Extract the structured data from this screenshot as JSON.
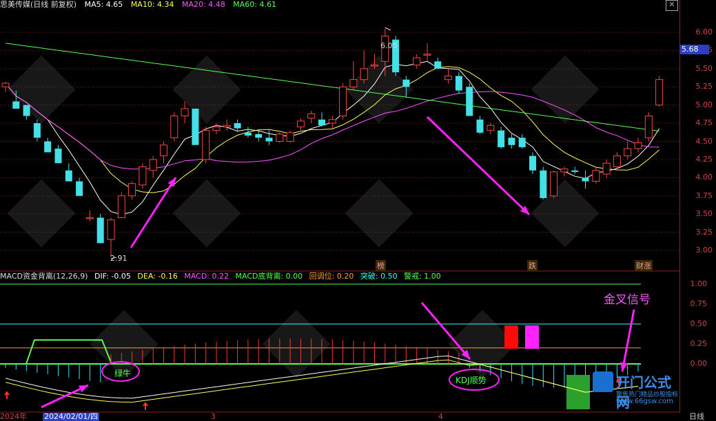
{
  "header": {
    "title": "思美传媒(日线 前复权)",
    "ma": [
      {
        "label": "MA5: 4.65",
        "color": "#ffffff"
      },
      {
        "label": "MA10: 4.34",
        "color": "#ffff55"
      },
      {
        "label": "MA20: 4.48",
        "color": "#ff55ff"
      },
      {
        "label": "MA60: 4.61",
        "color": "#55ff55"
      }
    ]
  },
  "price_axis": {
    "ticks": [
      "6.00",
      "5.75",
      "5.50",
      "5.25",
      "5.00",
      "4.75",
      "4.50",
      "4.25",
      "4.00",
      "3.75",
      "3.50",
      "3.25",
      "3.00"
    ],
    "current": "5.68"
  },
  "annotations": {
    "high": "6.05",
    "low": "2.91",
    "tag_bang": "榜",
    "tag_die": "跌",
    "tag_caizhang": "财涨"
  },
  "macd_header": {
    "name": "MACD资金背离(12,26,9)",
    "items": [
      {
        "label": "DIF: -0.05",
        "color": "#ffffff"
      },
      {
        "label": "DEA: -0.16",
        "color": "#ffff55"
      },
      {
        "label": "MACD: 0.22",
        "color": "#ff55ff"
      },
      {
        "label": "MACD底背离: 0.00",
        "color": "#55ff55"
      },
      {
        "label": "回调位: 0.20",
        "color": "#ff9933"
      },
      {
        "label": "突破: 0.50",
        "color": "#33ffff"
      },
      {
        "label": "警戒: 1.00",
        "color": "#55ff55"
      }
    ]
  },
  "macd_axis": {
    "ticks": [
      "1.00",
      "0.75",
      "0.50",
      "0.25",
      "0.00"
    ]
  },
  "macd_labels": {
    "green_cow": "绿牛",
    "kdj": "KDJ顺势",
    "golden_cross": "金叉信号"
  },
  "dates": {
    "year": "2024年",
    "sel": "2024/02/01/四",
    "m3": "3",
    "m4": "4",
    "period": "日线"
  },
  "watermark": {
    "brand": "开门公式网",
    "slogan": "聚焦热门精品炒股指标公式",
    "url": "www.66gsw.com"
  },
  "chart_data": {
    "type": "candlestick",
    "ylim": [
      2.85,
      6.25
    ],
    "candles": [
      [
        5.25,
        5.32,
        5.18,
        5.3
      ],
      [
        5.05,
        5.2,
        4.95,
        4.95
      ],
      [
        5.0,
        5.0,
        4.8,
        4.85
      ],
      [
        4.75,
        4.8,
        4.5,
        4.55
      ],
      [
        4.5,
        4.55,
        4.35,
        4.35
      ],
      [
        4.4,
        4.45,
        4.2,
        4.2
      ],
      [
        4.1,
        4.2,
        3.95,
        3.95
      ],
      [
        3.95,
        4.0,
        3.75,
        3.75
      ],
      [
        3.45,
        3.55,
        3.4,
        3.45
      ],
      [
        3.45,
        3.5,
        3.1,
        3.1
      ],
      [
        3.15,
        3.45,
        2.91,
        3.42
      ],
      [
        3.45,
        3.8,
        3.45,
        3.75
      ],
      [
        3.75,
        3.95,
        3.7,
        3.92
      ],
      [
        3.9,
        4.2,
        3.85,
        4.15
      ],
      [
        4.1,
        4.3,
        4.0,
        4.25
      ],
      [
        4.3,
        4.5,
        4.2,
        4.45
      ],
      [
        4.55,
        4.9,
        4.5,
        4.85
      ],
      [
        4.85,
        5.05,
        4.75,
        4.95
      ],
      [
        4.95,
        4.95,
        4.5,
        4.45
      ],
      [
        4.25,
        4.7,
        4.2,
        4.65
      ],
      [
        4.65,
        4.75,
        4.6,
        4.7
      ],
      [
        4.7,
        4.8,
        4.65,
        4.72
      ],
      [
        4.75,
        4.8,
        4.65,
        4.68
      ],
      [
        4.62,
        4.7,
        4.55,
        4.58
      ],
      [
        4.6,
        4.65,
        4.5,
        4.55
      ],
      [
        4.55,
        4.65,
        4.45,
        4.5
      ],
      [
        4.5,
        4.62,
        4.48,
        4.6
      ],
      [
        4.5,
        4.65,
        4.48,
        4.62
      ],
      [
        4.7,
        4.82,
        4.65,
        4.78
      ],
      [
        4.82,
        4.92,
        4.75,
        4.88
      ],
      [
        4.8,
        4.9,
        4.7,
        4.72
      ],
      [
        4.75,
        4.85,
        4.68,
        4.8
      ],
      [
        4.85,
        5.3,
        4.8,
        5.25
      ],
      [
        5.25,
        5.6,
        5.2,
        5.35
      ],
      [
        5.35,
        5.75,
        5.3,
        5.5
      ],
      [
        5.55,
        5.7,
        5.5,
        5.55
      ],
      [
        5.6,
        6.05,
        5.4,
        5.95
      ],
      [
        5.9,
        5.95,
        5.4,
        5.45
      ],
      [
        5.35,
        5.4,
        5.1,
        5.25
      ],
      [
        5.55,
        5.7,
        5.5,
        5.65
      ],
      [
        5.7,
        5.85,
        5.6,
        5.7
      ],
      [
        5.6,
        5.65,
        5.5,
        5.5
      ],
      [
        5.35,
        5.5,
        5.3,
        5.4
      ],
      [
        5.4,
        5.45,
        5.15,
        5.2
      ],
      [
        5.25,
        5.3,
        4.85,
        4.85
      ],
      [
        4.8,
        4.85,
        4.6,
        4.62
      ],
      [
        4.65,
        4.75,
        4.6,
        4.72
      ],
      [
        4.65,
        4.7,
        4.4,
        4.42
      ],
      [
        4.55,
        4.6,
        4.4,
        4.45
      ],
      [
        4.55,
        4.6,
        4.4,
        4.42
      ],
      [
        4.3,
        4.35,
        4.05,
        4.1
      ],
      [
        4.1,
        4.15,
        3.7,
        3.72
      ],
      [
        3.75,
        4.1,
        3.72,
        4.08
      ],
      [
        4.08,
        4.15,
        4.02,
        4.12
      ],
      [
        4.1,
        4.15,
        4.05,
        4.08
      ],
      [
        4.0,
        4.1,
        3.85,
        3.95
      ],
      [
        3.95,
        4.15,
        3.92,
        4.1
      ],
      [
        4.05,
        4.25,
        4.0,
        4.2
      ],
      [
        4.15,
        4.35,
        4.1,
        4.3
      ],
      [
        4.3,
        4.5,
        4.25,
        4.4
      ],
      [
        4.4,
        4.55,
        4.35,
        4.48
      ],
      [
        4.55,
        4.9,
        4.5,
        4.85
      ],
      [
        5.0,
        5.4,
        4.98,
        5.35
      ]
    ]
  }
}
